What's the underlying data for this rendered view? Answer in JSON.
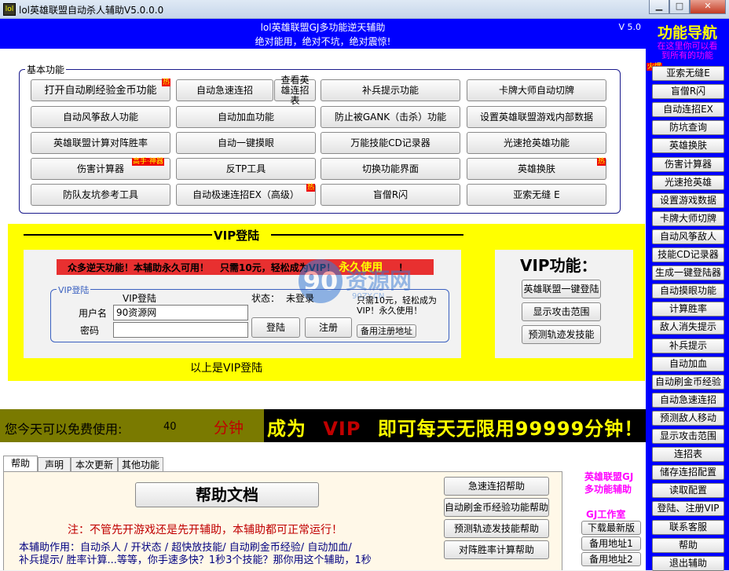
{
  "window": {
    "title": "lol英雄联盟自动杀人辅助V5.0.0.0",
    "icon_text": "lol",
    "minimize": "▁",
    "maximize": "□",
    "close": "✕"
  },
  "header": {
    "line1": "lol英雄联盟GJ多功能逆天辅助",
    "line2": "绝对能用，绝对不坑，绝对震惊!",
    "version": "V 5.0"
  },
  "basic": {
    "label": "基本功能",
    "buttons": [
      "打开自动刷经验金币功能",
      "自动急速连招",
      "查看英雄连招表",
      "补兵提示功能",
      "卡牌大师自动切牌",
      "自动风筝敌人功能",
      "自动加血功能",
      "防止被GANK（击杀）功能",
      "设置英雄联盟游戏内部数据",
      "英雄联盟计算对阵胜率",
      "自动一键摸眼",
      "万能技能CD记录器",
      "光速抢英雄功能",
      "伤害计算器",
      "反TP工具",
      "切换功能界面",
      "英雄换肤",
      "防队友坑参考工具",
      "自动极速连招EX（高级）",
      "盲僧R闪",
      "亚索无缝 E"
    ],
    "tags": {
      "hot": "热",
      "expert": "高手·神器"
    }
  },
  "vip": {
    "title": "VIP登陆",
    "banner_a": "众多逆天功能！本辅助永久可用！",
    "banner_b": "只需10元，轻松成为VIP！",
    "banner_c": "永久使用",
    "banner_d": "！",
    "login_group": "VIP登陆",
    "login_heading": "VIP登陆",
    "status_label": "状态：",
    "status_value": "未登录",
    "username_label": "用户名",
    "username_value": "90资源网",
    "password_label": "密码",
    "password_value": "",
    "login_btn": "登陆",
    "register_btn": "注册",
    "promo": "只需10元，轻松成为VIP！永久使用！",
    "backup_register_btn": "备用注册地址",
    "footer": "以上是VIP登陆",
    "watermark_main": "资源网",
    "watermark_sub": "90ZY.CN",
    "features_title": "VIP功能：",
    "features": [
      "英雄联盟一键登陆",
      "显示攻击范围",
      "预测轨迹发技能"
    ]
  },
  "ticker": {
    "free_text": "您今天可以免费使用:",
    "free_minutes": "40",
    "unit": "分钟",
    "slogan_a": "成为",
    "slogan_b": "VIP",
    "slogan_c": "即可每天无限用99999分钟！"
  },
  "tabs": [
    "帮助",
    "声明",
    "本次更新",
    "其他功能"
  ],
  "help": {
    "doc_btn": "帮助文档",
    "note": "注：不管先开游戏还是先开辅助，本辅助都可正常运行！",
    "desc1": "本辅助作用：自动杀人 / 开状态 / 超快放技能/ 自动刷金币经验/ 自动加血/",
    "desc2": "补兵提示/ 胜率计算...等等，你手速多快？1秒3个技能？那你用这个辅助，1秒",
    "side_buttons": [
      "急速连招帮助",
      "自动刷金币经验功能帮助",
      "预测轨迹发技能帮助",
      "对阵胜率计算帮助"
    ]
  },
  "studio": {
    "brand1": "英雄联盟GJ",
    "brand2": "多功能辅助",
    "name": "GJ工作室",
    "buttons": [
      "下载最新版",
      "备用地址1",
      "备用地址2"
    ]
  },
  "nav": {
    "title": "功能导航",
    "sub1": "在这里你可以看",
    "sub2": "到所有的功能",
    "hot": "火爆",
    "items": [
      "亚索无缝E",
      "盲僧R闪",
      "自动连招EX",
      "防坑查询",
      "英雄换肤",
      "伤害计算器",
      "光速抢英雄",
      "设置游戏数据",
      "卡牌大师切牌",
      "自动风筝敌人",
      "技能CD记录器",
      "生成一键登陆器",
      "自动摸眼功能",
      "计算胜率",
      "敌人消失提示",
      "补兵提示",
      "自动加血",
      "自动刷金币经验",
      "自动急速连招",
      "预测敌人移动",
      "显示攻击范围",
      "连招表",
      "储存连招配置",
      "读取配置",
      "登陆、注册VIP",
      "联系客服",
      "帮助",
      "退出辅助"
    ]
  },
  "colors": {
    "blue": "#0000ff",
    "yellow": "#ffff00",
    "red": "#e00000",
    "magenta": "#ff00ff"
  }
}
